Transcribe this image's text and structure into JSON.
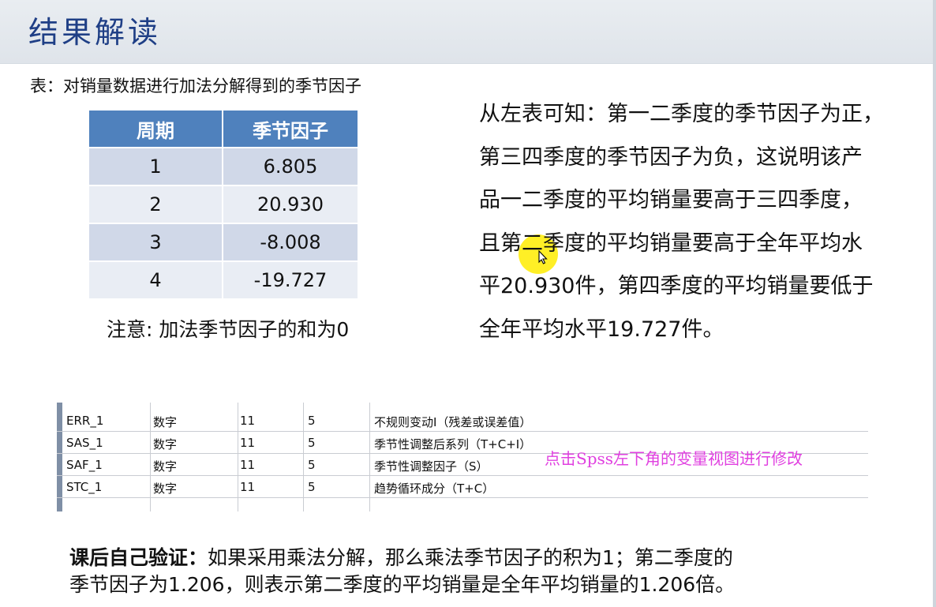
{
  "header": {
    "title": "结果解读"
  },
  "table": {
    "caption": "表：对销量数据进行加法分解得到的季节因子",
    "columns": [
      "周期",
      "季节因子"
    ],
    "rows": [
      [
        "1",
        "6.805"
      ],
      [
        "2",
        "20.930"
      ],
      [
        "3",
        "-8.008"
      ],
      [
        "4",
        "-19.727"
      ]
    ],
    "note": "注意: 加法季节因子的和为0"
  },
  "explanation": {
    "lines": [
      "从左表可知：第一二季度的季节因子为正，",
      "第三四季度的季节因子为负，这说明该产",
      "品一二季度的平均销量要高于三四季度，",
      "且第二季度的平均销量要高于全年平均水",
      "平20.930件，第四季度的平均销量要低于",
      "全年平均水平19.727件。"
    ]
  },
  "spss": {
    "rows": [
      [
        "ERR_1",
        "数字",
        "11",
        "5",
        "不规则变动I（残差或误差值）"
      ],
      [
        "SAS_1",
        "数字",
        "11",
        "5",
        "季节性调整后系列（T+C+I）"
      ],
      [
        "SAF_1",
        "数字",
        "11",
        "5",
        "季节性调整因子（S）"
      ],
      [
        "STC_1",
        "数字",
        "11",
        "5",
        "趋势循环成分（T+C）"
      ]
    ],
    "note": "点击Spss左下角的变量视图进行修改"
  },
  "footer": {
    "bold_label": "课后自己验证：",
    "text_line1": "如果采用乘法分解，那么乘法季节因子的积为1；第二季度的",
    "text_line2": "季节因子为1.206，则表示第二季度的平均销量是全年平均销量的1.206倍。"
  },
  "colors": {
    "title": "#1f3f86",
    "table_header": "#4f81bd",
    "table_row_odd": "#d0d8e8",
    "table_row_even": "#e9edf4",
    "spss_note": "#e040e0",
    "highlight": "#ffec00"
  }
}
